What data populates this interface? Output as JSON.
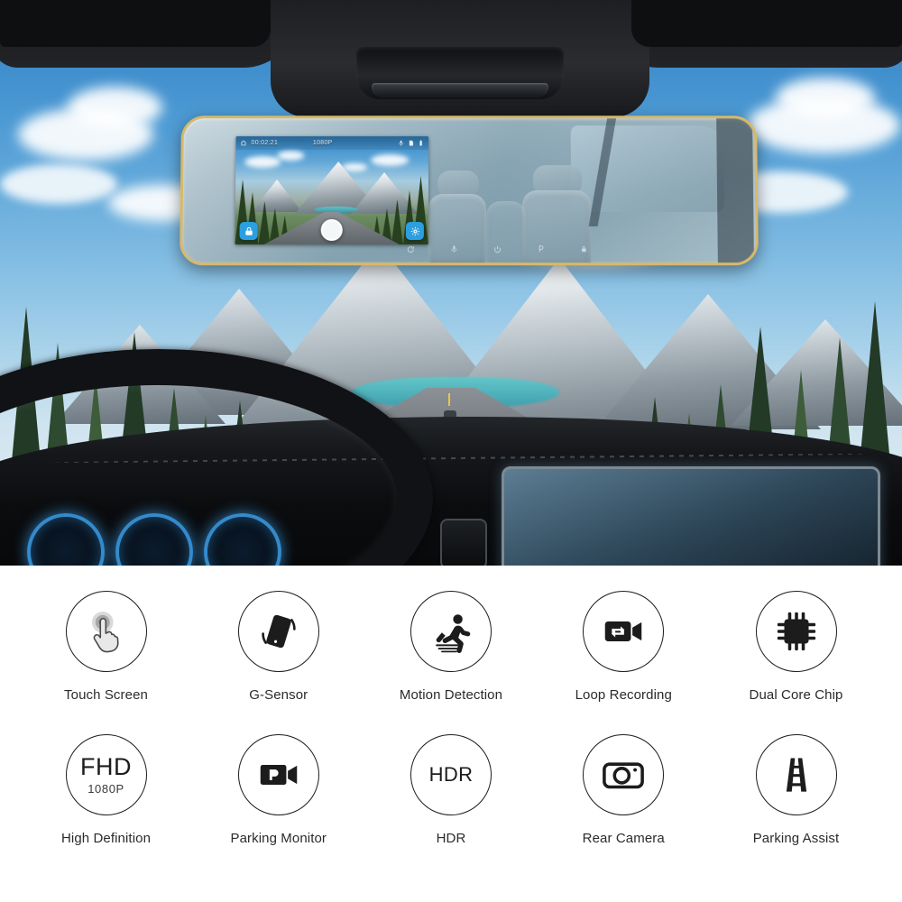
{
  "hero": {
    "scene_description": "Interior car view with rear-view mirror dash cam, mountain road ahead",
    "device": {
      "frame_color": "#d8b968",
      "screen": {
        "status_bar": {
          "home_icon": "home-icon",
          "recording_time": "00:02:21",
          "resolution": "1080P",
          "right_icons": [
            "microphone-icon",
            "sd-card-icon",
            "battery-icon"
          ]
        },
        "left_button_icon": "lock-record-icon",
        "shutter_button_icon": "shutter-icon",
        "right_button_icon": "settings-gear-icon",
        "preview_description": "Mountain road driving preview"
      },
      "bezel_controls": [
        {
          "name": "reset-icon",
          "label": "Reset"
        },
        {
          "name": "microphone-icon",
          "label": "Mic"
        },
        {
          "name": "power-icon",
          "label": "Power"
        },
        {
          "name": "parking-icon",
          "label": "P"
        },
        {
          "name": "lock-icon",
          "label": "Lock"
        }
      ]
    }
  },
  "features": {
    "rows": [
      [
        {
          "icon": "touch-hand-icon",
          "label": "Touch Screen"
        },
        {
          "icon": "phone-tilt-icon",
          "label": "G-Sensor"
        },
        {
          "icon": "running-person-icon",
          "label": "Motion Detection"
        },
        {
          "icon": "loop-video-camera-icon",
          "label": "Loop Recording"
        },
        {
          "icon": "cpu-chip-icon",
          "label": "Dual Core Chip"
        }
      ],
      [
        {
          "icon": "fhd-text-icon",
          "label": "High Definition",
          "icon_text": "FHD",
          "icon_subtext": "1080P"
        },
        {
          "icon": "parking-video-camera-icon",
          "label": "Parking Monitor"
        },
        {
          "icon": "hdr-text-icon",
          "label": "HDR",
          "icon_text": "HDR"
        },
        {
          "icon": "photo-camera-icon",
          "label": "Rear Camera"
        },
        {
          "icon": "road-lanes-icon",
          "label": "Parking Assist"
        }
      ]
    ]
  },
  "colors": {
    "accent_blue": "#2b9fe0",
    "mirror_gold": "#d8b968",
    "icon_stroke": "#1c1c1c",
    "label_text": "#2b2b2b",
    "panel_background": "#ffffff"
  }
}
